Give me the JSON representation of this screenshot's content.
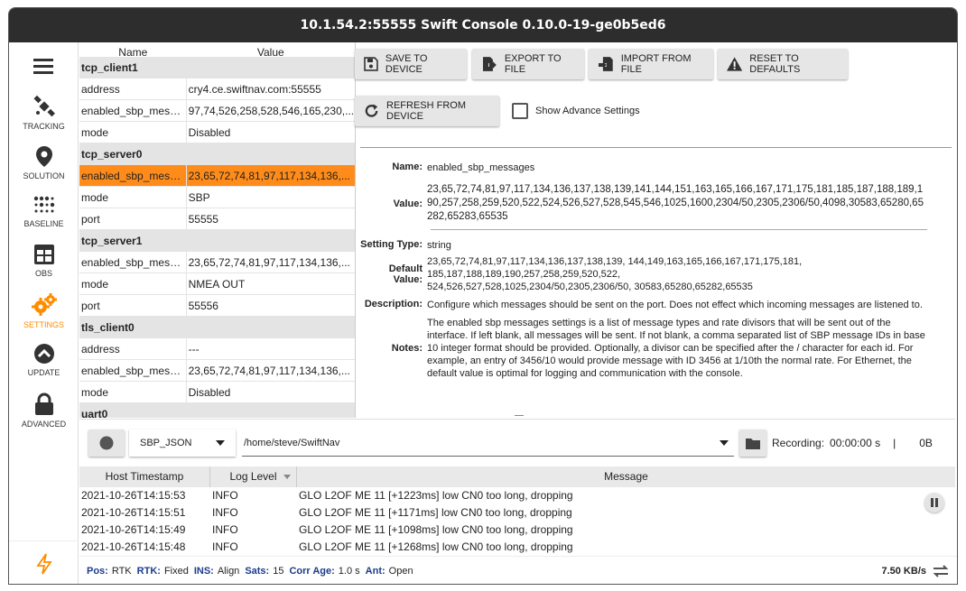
{
  "window": {
    "title": "10.1.54.2:55555 Swift Console 0.10.0-19-ge0b5ed6"
  },
  "sidebar": {
    "items": [
      {
        "label": "TRACKING",
        "icon": "satellite-icon"
      },
      {
        "label": "SOLUTION",
        "icon": "location-pin-icon"
      },
      {
        "label": "BASELINE",
        "icon": "dots-grid-icon"
      },
      {
        "label": "OBS",
        "icon": "table-icon"
      },
      {
        "label": "SETTINGS",
        "icon": "gears-icon"
      },
      {
        "label": "UPDATE",
        "icon": "upload-icon"
      },
      {
        "label": "ADVANCED",
        "icon": "lock-icon"
      }
    ],
    "active": "SETTINGS",
    "accent": "#ff8c00"
  },
  "settings_table": {
    "col_name": "Name",
    "col_value": "Value",
    "rows": [
      {
        "type": "group",
        "name": "tcp_client1"
      },
      {
        "type": "row",
        "name": "address",
        "value": "cry4.ce.swiftnav.com:55555"
      },
      {
        "type": "row",
        "name": "enabled_sbp_messages",
        "value": "97,74,526,258,528,546,165,230,..."
      },
      {
        "type": "row",
        "name": "mode",
        "value": "Disabled"
      },
      {
        "type": "group",
        "name": "tcp_server0"
      },
      {
        "type": "row",
        "name": "enabled_sbp_messages",
        "value": "23,65,72,74,81,97,117,134,136,...",
        "selected": true
      },
      {
        "type": "row",
        "name": "mode",
        "value": "SBP"
      },
      {
        "type": "row",
        "name": "port",
        "value": "55555"
      },
      {
        "type": "group",
        "name": "tcp_server1"
      },
      {
        "type": "row",
        "name": "enabled_sbp_messages",
        "value": "23,65,72,74,81,97,117,134,136,..."
      },
      {
        "type": "row",
        "name": "mode",
        "value": "NMEA OUT"
      },
      {
        "type": "row",
        "name": "port",
        "value": "55556"
      },
      {
        "type": "group",
        "name": "tls_client0"
      },
      {
        "type": "row",
        "name": "address",
        "value": "---"
      },
      {
        "type": "row",
        "name": "enabled_sbp_messages",
        "value": "23,65,72,74,81,97,117,134,136,..."
      },
      {
        "type": "row",
        "name": "mode",
        "value": "Disabled"
      },
      {
        "type": "group",
        "name": "uart0"
      }
    ]
  },
  "toolbar": {
    "save": "SAVE TO DEVICE",
    "export": "EXPORT TO FILE",
    "import": "IMPORT FROM FILE",
    "reset": "RESET TO DEFAULTS",
    "refresh": "REFRESH FROM DEVICE",
    "show_advanced": "Show Advance Settings"
  },
  "details": {
    "name_label": "Name:",
    "name": "enabled_sbp_messages",
    "value_label": "Value:",
    "value": "23,65,72,74,81,97,117,134,136,137,138,139,141,144,151,163,165,166,167,171,175,181,185,187,188,189,190,257,258,259,520,522,524,526,527,528,545,546,1025,1600,2304/50,2305,2306/50,4098,30583,65280,65282,65283,65535",
    "type_label": "Setting Type:",
    "type": "string",
    "default_label": "Default Value:",
    "default": "23,65,72,74,81,97,117,134,136,137,138,139, 144,149,163,165,166,167,171,175,181, 185,187,188,189,190,257,258,259,520,522, 524,526,527,528,1025,2304/50,2305,2306/50, 30583,65280,65282,65535",
    "desc_label": "Description:",
    "description": "Configure which messages should be sent on the port. Does not effect which incoming messages are listened to.",
    "notes_label": "Notes:",
    "notes": "The enabled sbp messages settings is a list of message types and rate divisors that will be sent out of the interface. If left blank, all messages will be sent. If not blank, a comma separated list of SBP message IDs in base 10 integer format should be provided. Optionally, a divisor can be specified after the / character for each id. For example, an entry of 3456/10 would provide message with ID 3456 at 1/10th the normal rate. For Ethernet, the default value is optimal for logging and communication with the console."
  },
  "recording": {
    "format": "SBP_JSON",
    "path": "/home/steve/SwiftNav",
    "label": "Recording:",
    "time": "00:00:00 s",
    "sep": "|",
    "size": "0B"
  },
  "log": {
    "col_time": "Host Timestamp",
    "col_level": "Log Level",
    "col_msg": "Message",
    "rows": [
      {
        "time": "2021-10-26T14:15:53",
        "level": "INFO",
        "msg": "GLO L2OF ME 11 [+1223ms] low CN0 too long, dropping"
      },
      {
        "time": "2021-10-26T14:15:51",
        "level": "INFO",
        "msg": "GLO L2OF ME 11 [+1171ms] low CN0 too long, dropping"
      },
      {
        "time": "2021-10-26T14:15:49",
        "level": "INFO",
        "msg": "GLO L2OF ME 11 [+1098ms] low CN0 too long, dropping"
      },
      {
        "time": "2021-10-26T14:15:48",
        "level": "INFO",
        "msg": "GLO L2OF ME 11 [+1268ms] low CN0 too long, dropping"
      }
    ]
  },
  "status": {
    "pos_label": "Pos:",
    "pos": "RTK",
    "rtk_label": "RTK:",
    "rtk": "Fixed",
    "ins_label": "INS:",
    "ins": "Align",
    "sats_label": "Sats:",
    "sats": "15",
    "corr_label": "Corr Age:",
    "corr": "1.0 s",
    "ant_label": "Ant:",
    "ant": "Open",
    "rate": "7.50 KB/s"
  }
}
